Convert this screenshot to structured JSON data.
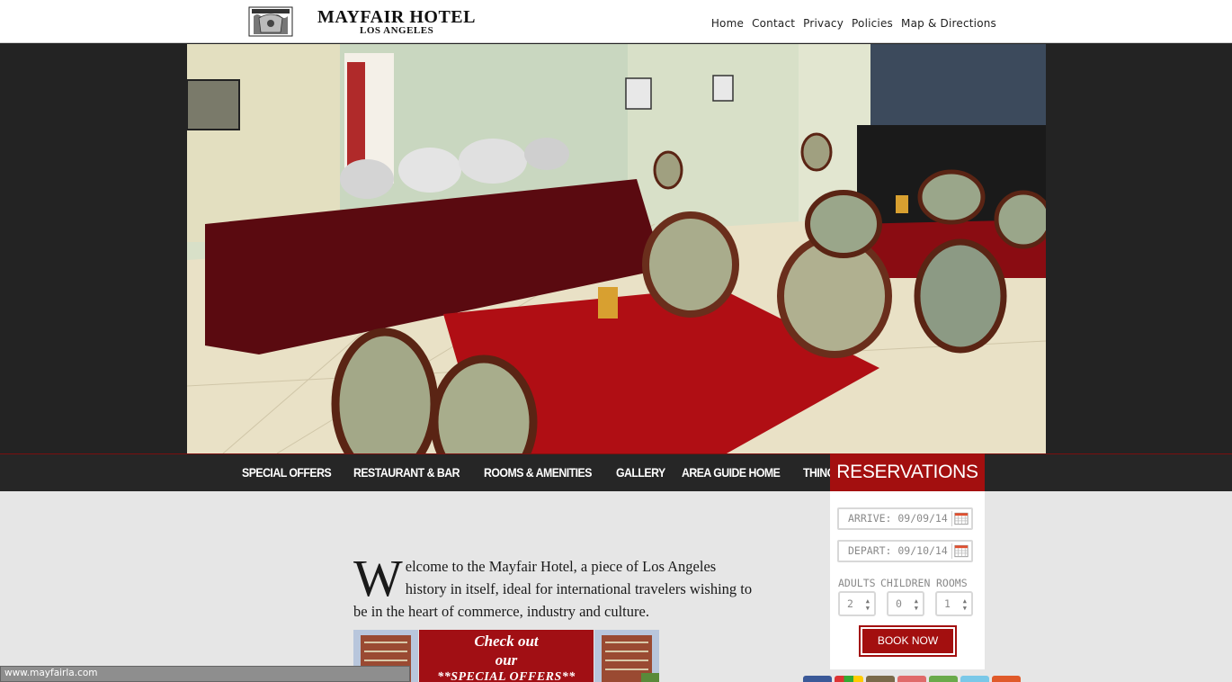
{
  "brand": {
    "name": "MAYFAIR HOTEL",
    "city": "LOS ANGELES"
  },
  "top_nav": [
    "Home",
    "Contact",
    "Privacy",
    "Policies",
    "Map & Directions"
  ],
  "main_nav": [
    "SPECIAL OFFERS",
    "RESTAURANT & BAR",
    "ROOMS & AMENITIES",
    "GALLERY",
    "AREA GUIDE HOME",
    "THINGS TO DO"
  ],
  "reservations": {
    "title": "RESERVATIONS",
    "arrive": "ARRIVE: 09/09/14",
    "depart": "DEPART: 09/10/14",
    "labels": {
      "adults": "ADULTS",
      "children": "CHILDREN",
      "rooms": "ROOMS"
    },
    "values": {
      "adults": "2",
      "children": "0",
      "rooms": "1"
    },
    "book_label": "BOOK NOW"
  },
  "welcome": {
    "drop_cap": "W",
    "text": "elcome to the Mayfair Hotel, a piece of Los Angeles history in itself, ideal for international travelers wishing to be in the heart of commerce, industry and culture."
  },
  "promo": {
    "line1": "Check out",
    "line2": "our",
    "line3": "**SPECIAL OFFERS**"
  },
  "status_url": "www.mayfairla.com",
  "colors": {
    "accent": "#a30f0f",
    "nav_bg": "#262626",
    "page_bg": "#e6e6e6"
  },
  "social_icons": [
    "facebook-icon",
    "google-icon",
    "tripadvisor-icon",
    "yelp-icon",
    "foursquare-icon",
    "twitter-icon",
    "rss-icon"
  ]
}
